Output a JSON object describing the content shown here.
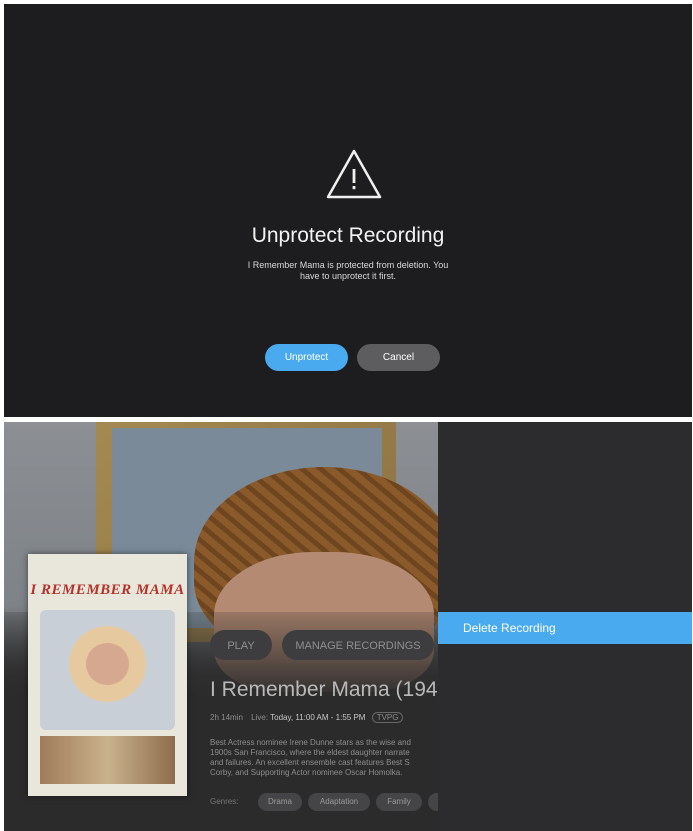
{
  "dialog": {
    "icon": "warning-triangle-icon",
    "title": "Unprotect Recording",
    "message_line1": "I Remember Mama is protected from deletion. You",
    "message_line2": "have to unprotect it first.",
    "primary_button": "Unprotect",
    "secondary_button": "Cancel",
    "colors": {
      "background": "#1d1d1f",
      "primary": "#4aaaf0",
      "secondary": "#5d5d5f"
    }
  },
  "detail": {
    "poster_title": "I REMEMBER MAMA",
    "buttons": {
      "play": "PLAY",
      "manage": "MANAGE RECORDINGS"
    },
    "title": "I Remember Mama (194",
    "meta": {
      "duration": "2h 14min",
      "label": "Live:",
      "time": "Today, 11:00 AM - 1:55 PM",
      "rating": "TVPG"
    },
    "description": [
      "Best Actress nominee Irene Dunne stars as the wise and",
      "1900s San Francisco, where the eldest daughter narrate",
      "and failures. An excellent ensemble cast features Best S",
      "Corby, and Supporting Actor nominee Oscar Homolka."
    ],
    "genres_label": "Genres:",
    "genres": [
      "Drama",
      "Adaptation",
      "Family"
    ]
  },
  "menu": {
    "items": [
      {
        "label": "Delete Recording",
        "selected": true
      }
    ],
    "accent": "#4aaaf0"
  }
}
